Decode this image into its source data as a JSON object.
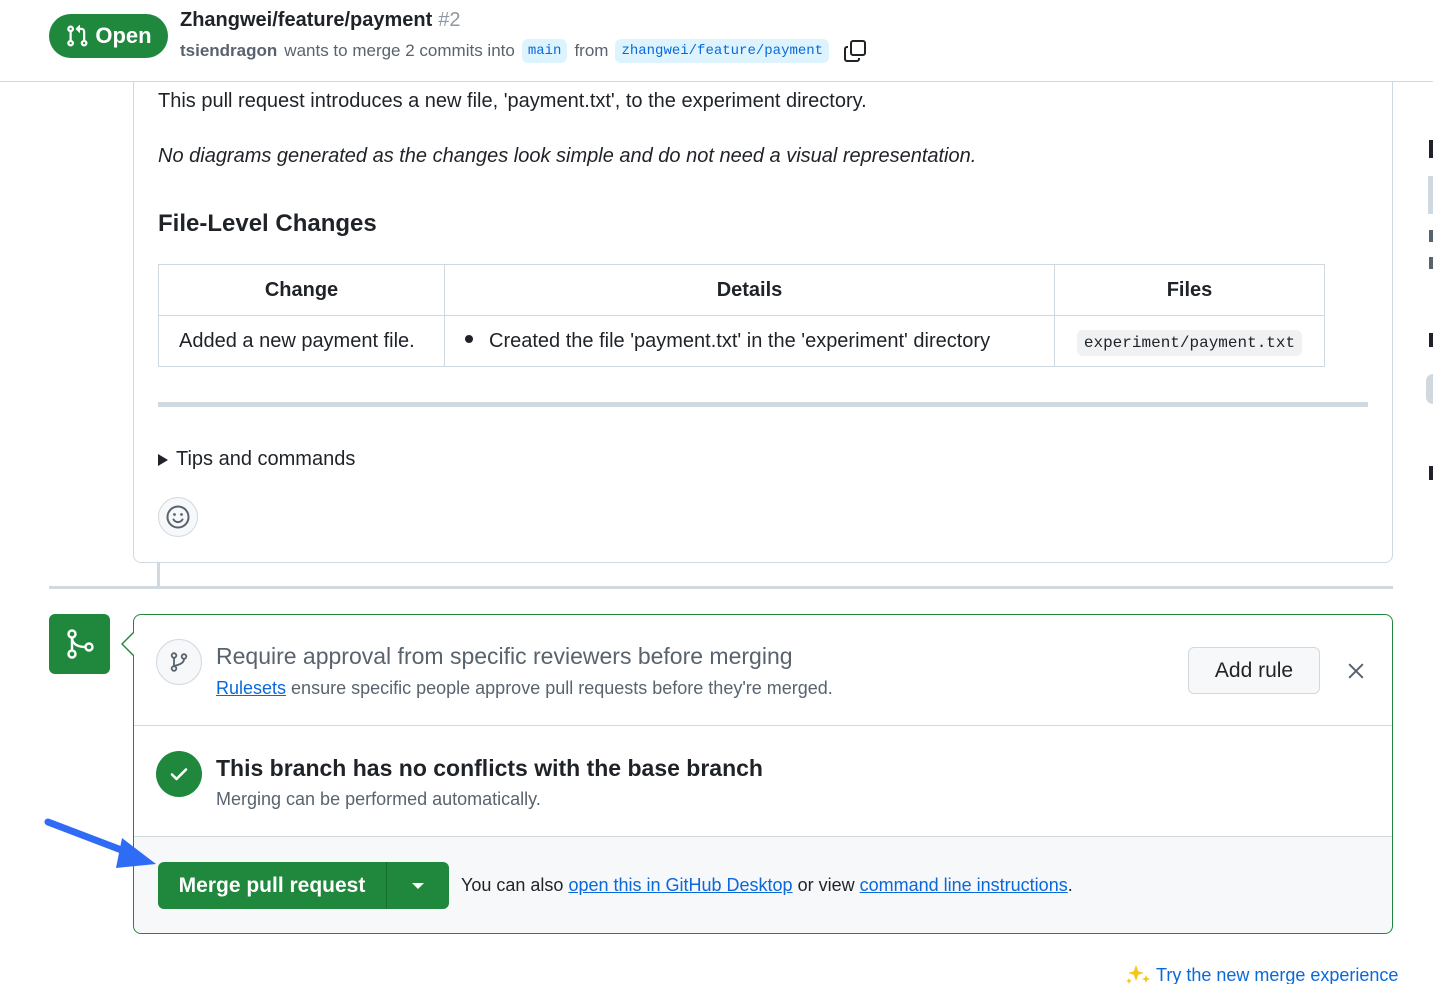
{
  "header": {
    "state": "Open",
    "title": "Zhangwei/feature/payment",
    "number": "#2",
    "author": "tsiendragon",
    "merge_text": "wants to merge 2 commits into",
    "base_branch": "main",
    "from_text": "from",
    "head_branch": "zhangwei/feature/payment"
  },
  "description": {
    "paragraph": "This pull request introduces a new file, 'payment.txt', to the experiment directory.",
    "note": "No diagrams generated as the changes look simple and do not need a visual representation.",
    "heading": "File-Level Changes",
    "table": {
      "headers": [
        "Change",
        "Details",
        "Files"
      ],
      "rows": [
        {
          "change": "Added a new payment file.",
          "details": "Created the file 'payment.txt' in the 'experiment' directory",
          "files": "experiment/payment.txt"
        }
      ]
    },
    "tips_label": "Tips and commands"
  },
  "ruleset_prompt": {
    "title": "Require approval from specific reviewers before merging",
    "link": "Rulesets",
    "desc": "ensure specific people approve pull requests before they're merged.",
    "add_rule": "Add rule"
  },
  "merge_status": {
    "title": "This branch has no conflicts with the base branch",
    "desc": "Merging can be performed automatically."
  },
  "merge_actions": {
    "button": "Merge pull request",
    "also_text": "You can also",
    "desktop_link": "open this in GitHub Desktop",
    "or_view": "or view",
    "cli_link": "command line instructions",
    "period": "."
  },
  "footer": {
    "try_new": "Try the new merge experience"
  },
  "colors": {
    "success": "#1f883d",
    "link": "#0969da",
    "annotation_arrow": "#2f6cf5"
  }
}
